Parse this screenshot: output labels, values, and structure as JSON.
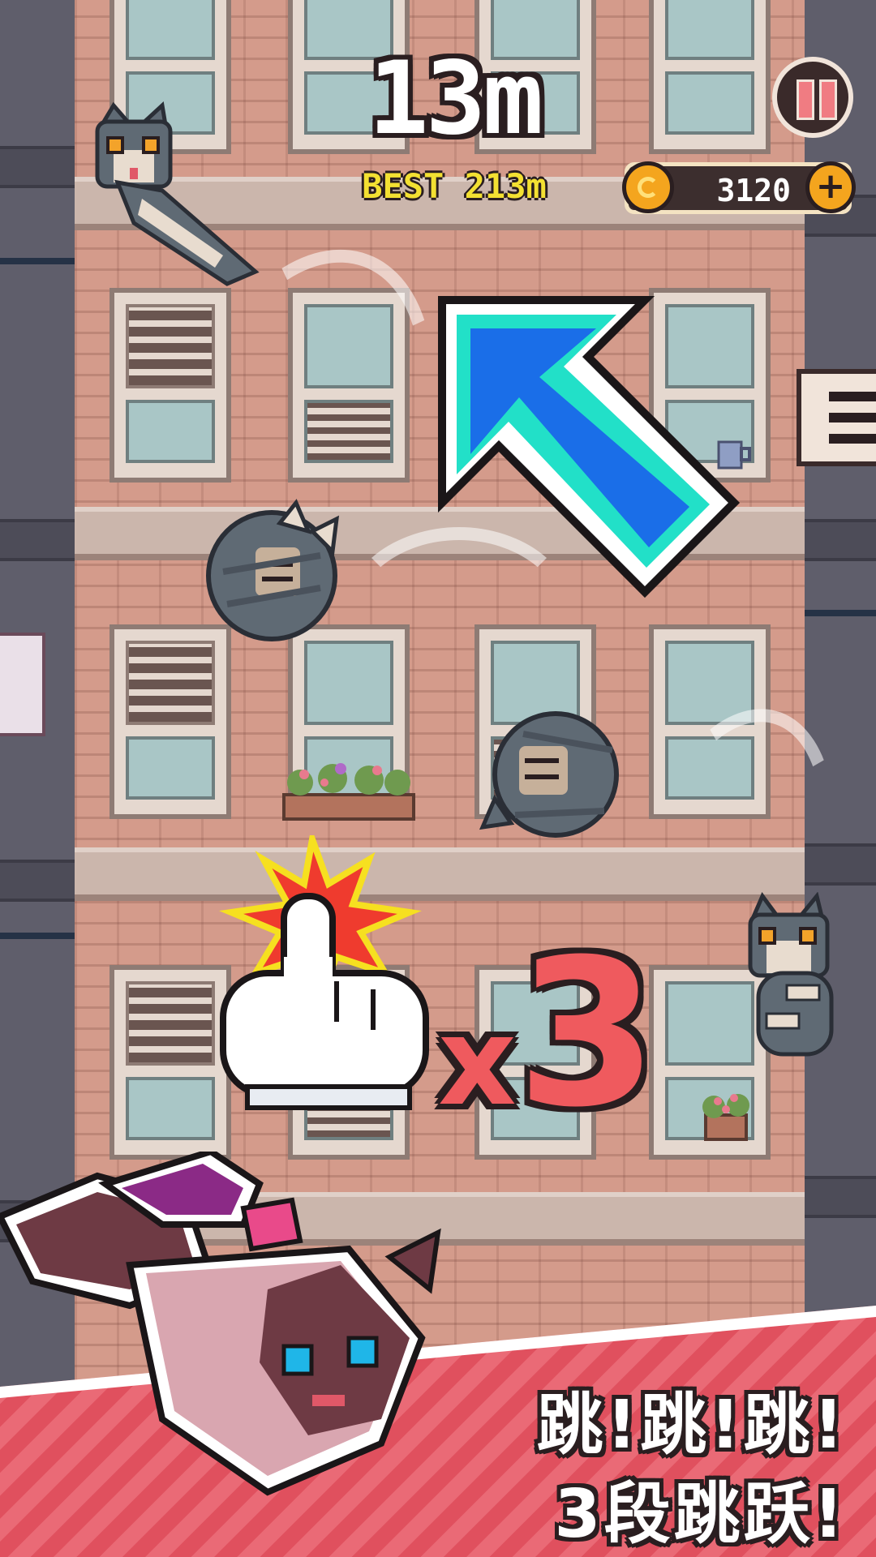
{
  "hud": {
    "distance": "13m",
    "best": "BEST 213m",
    "coins": "3120",
    "add_symbol": "+"
  },
  "tutorial": {
    "multiplier_x": "x",
    "multiplier_n": "3"
  },
  "promo": {
    "line1": "跳!跳!跳!",
    "line2": "3段跳跃!"
  },
  "colors": {
    "arrow": "#1a6ee8",
    "arrow_outline": "#22e0c8",
    "multiplier": "#ef5a5e",
    "coin": "#f4a51e",
    "best_text": "#f3e032",
    "banner": "#e0505e"
  },
  "icons": [
    "pause-icon",
    "coin-icon",
    "plus-icon",
    "menu-icon",
    "tap-hand-icon",
    "up-left-arrow-icon"
  ]
}
